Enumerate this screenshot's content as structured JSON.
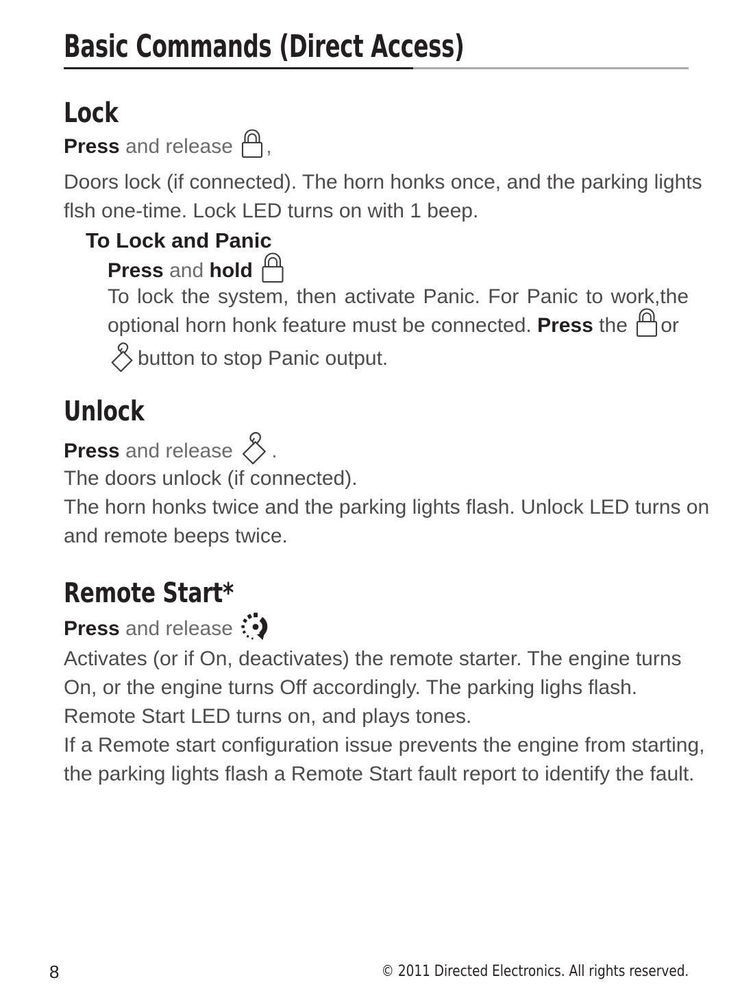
{
  "document": {
    "title": "Basic Commands (Direct Access)",
    "page_number": "8",
    "copyright": "© 2011 Directed Electronics. All rights reserved."
  },
  "colors": {
    "text": "#231f20",
    "body_text": "#4d4a4b",
    "rule": "#a7a9ac",
    "background": "#ffffff"
  },
  "icons": {
    "lock": "padlock-closed-icon",
    "unlock": "padlock-open-icon",
    "remote_start": "remote-start-icon"
  },
  "sections": [
    {
      "heading": "Lock",
      "press_label": "Press",
      "and_label": "and",
      "release_label": "release",
      "trailing_punct": ",",
      "body": "Doors lock (if connected).  The horn honks once, and the parking lights flsh one-time. Lock LED turns on with 1 beep.",
      "body_lines": [
        "Doors lock (if connected).  The horn honks once, and the parking lights",
        "flsh one-time. Lock LED turns on with 1 beep."
      ],
      "subsection": {
        "heading": "To Lock and Panic",
        "press_label": "Press",
        "and_label": "and",
        "hold_label": "hold",
        "body_part1": "To lock the system, then activate Panic. For Panic to work,the optional horn honk feature must be connected. ",
        "body_press": "Press",
        "body_part2": " the ",
        "body_or": "or",
        "body_part3": "button to stop Panic output."
      }
    },
    {
      "heading": "Unlock",
      "press_label": "Press",
      "and_label": "and",
      "release_label": "release",
      "trailing_punct": ".",
      "body_lines": [
        "The doors unlock (if connected).",
        "The horn honks twice and the parking lights flash. Unlock LED turns on",
        "and remote beeps twice."
      ]
    },
    {
      "heading": "Remote Start*",
      "press_label": "Press",
      "and_label": "and",
      "release_label": "release",
      "body_lines": [
        "Activates (or if On, deactivates) the remote starter. The engine turns",
        "On, or the engine turns Off accordingly.   The parking lighs flash.",
        "Remote Start LED turns on, and plays tones."
      ],
      "body_lines2": [
        "If a Remote start configuration issue prevents the engine from starting,",
        "the parking lights flash a Remote Start fault report to identify the fault."
      ]
    }
  ]
}
